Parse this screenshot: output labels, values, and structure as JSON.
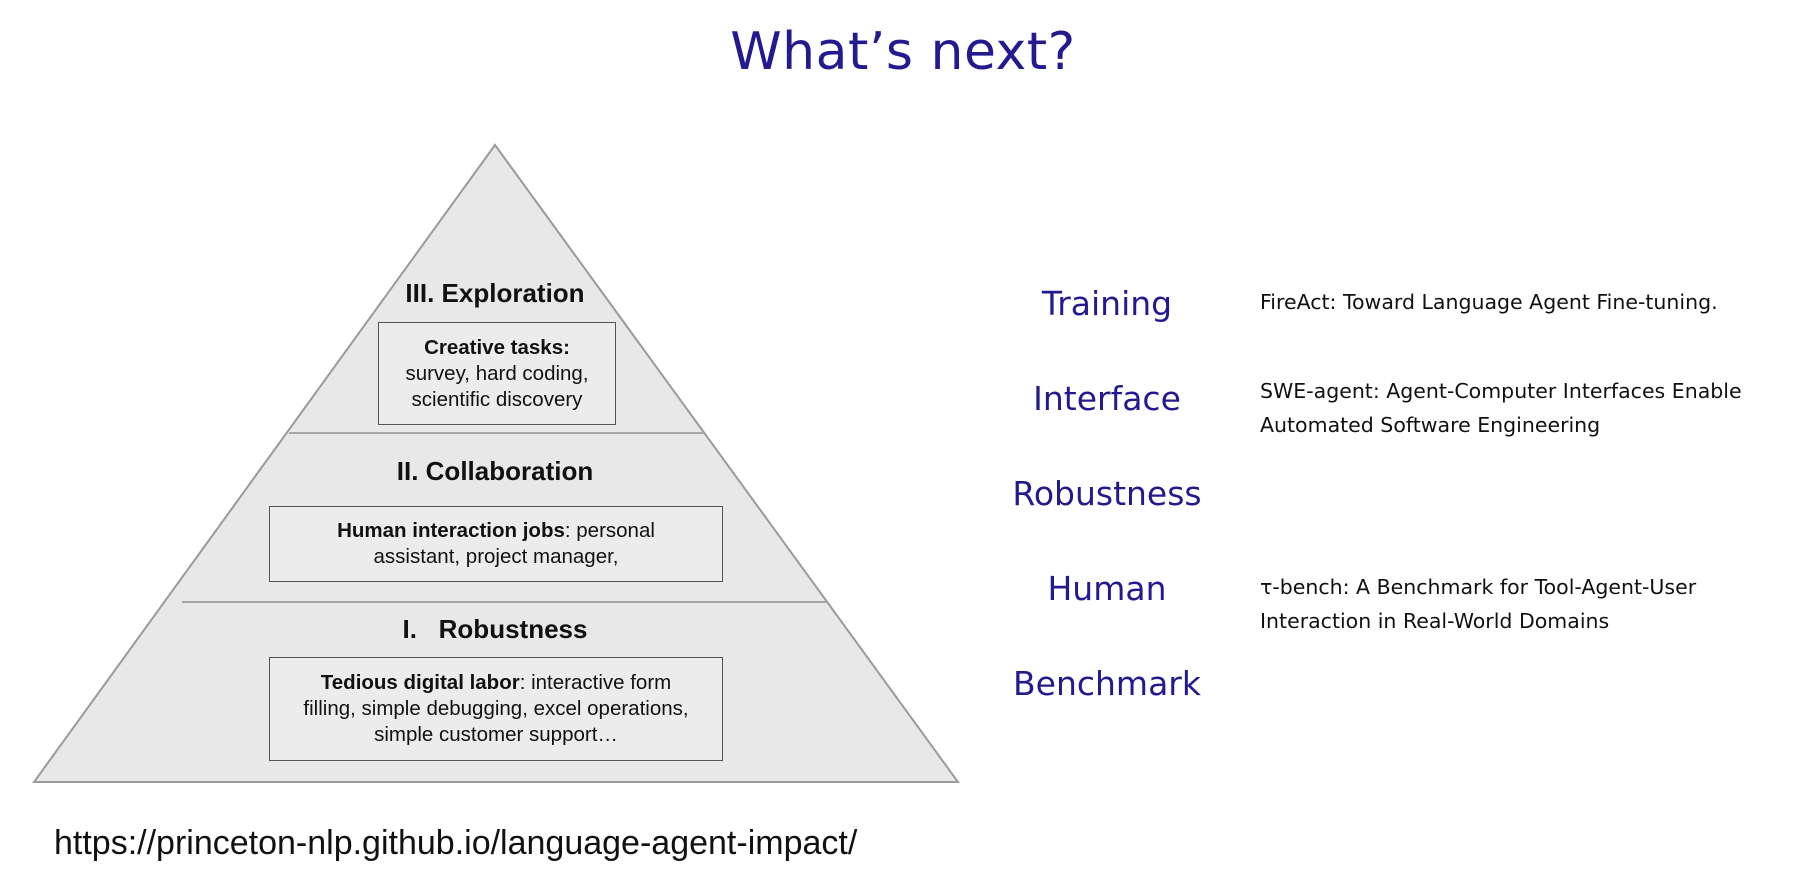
{
  "slide": {
    "title": "What’s next?",
    "url": "https://princeton-nlp.github.io/language-agent-impact/"
  },
  "pyramid": {
    "tiers": [
      {
        "title": "III. Exploration",
        "box_bold": "Creative tasks:",
        "box_lines": [
          "survey, hard coding,",
          "scientific discovery"
        ]
      },
      {
        "title": "II. Collaboration",
        "box_bold": "Human interaction jobs",
        "box_rest": ": personal",
        "box_lines": [
          "assistant, project manager,"
        ]
      },
      {
        "title": "I.   Robustness",
        "box_bold": "Tedious digital labor",
        "box_rest": ": interactive form",
        "box_lines": [
          "filling, simple debugging, excel operations,",
          "simple customer support…"
        ]
      }
    ]
  },
  "topics": [
    {
      "label": "Training",
      "paper_lines": [
        "FireAct: Toward Language Agent Fine-tuning."
      ]
    },
    {
      "label": "Interface",
      "paper_lines": [
        "SWE-agent: Agent-Computer Interfaces Enable",
        "Automated Software Engineering"
      ]
    },
    {
      "label": "Robustness",
      "paper_lines": []
    },
    {
      "label": "Human",
      "paper_lines": [
        "τ-bench: A Benchmark for Tool-Agent-User",
        "Interaction in Real-World Domains"
      ]
    },
    {
      "label": "Benchmark",
      "paper_lines": []
    }
  ],
  "colors": {
    "title_accent": "#241a8f",
    "pyramid_fill": "#e8e8e8",
    "pyramid_stroke": "#9a9a9a",
    "box_border": "#555555"
  }
}
